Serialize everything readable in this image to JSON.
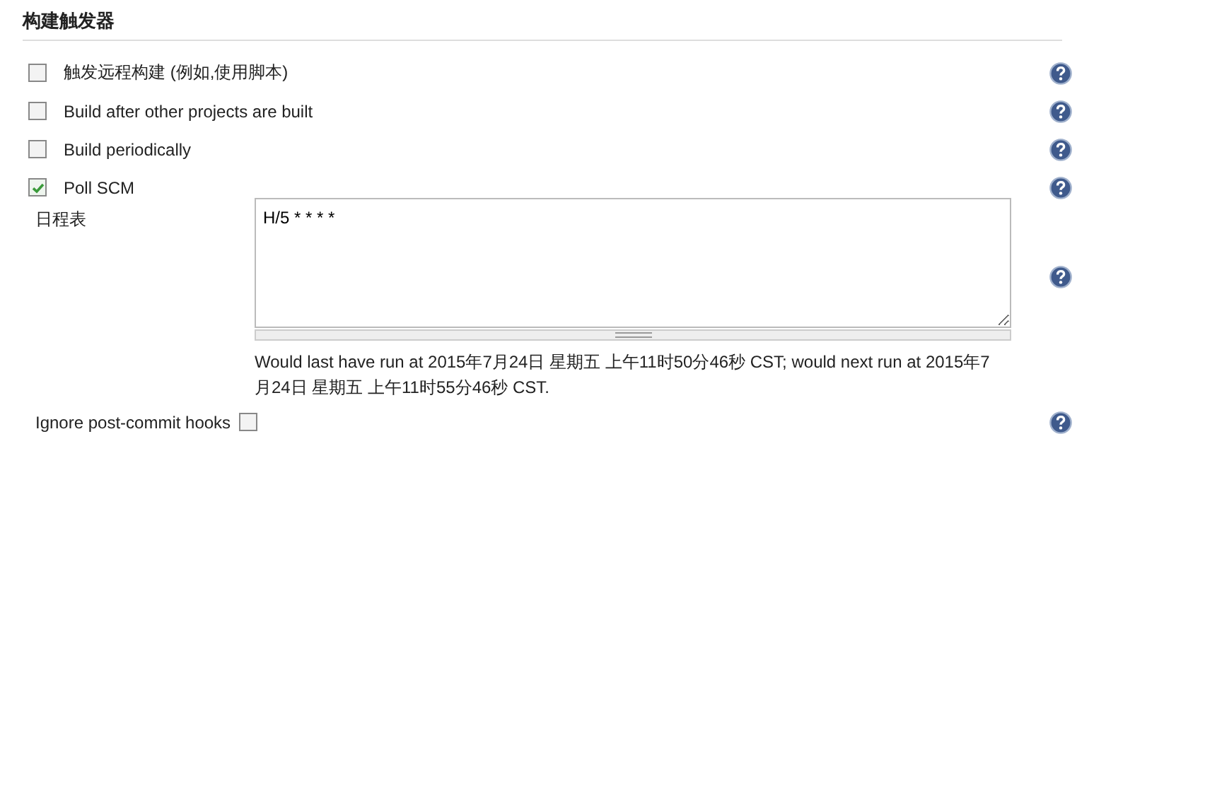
{
  "section": {
    "title": "构建触发器"
  },
  "triggers": [
    {
      "label": "触发远程构建 (例如,使用脚本)",
      "checked": false
    },
    {
      "label": "Build after other projects are built",
      "checked": false
    },
    {
      "label": "Build periodically",
      "checked": false
    },
    {
      "label": "Poll SCM",
      "checked": true
    }
  ],
  "schedule": {
    "label": "日程表",
    "value": "H/5 * * * *",
    "message": "Would last have run at 2015年7月24日 星期五 上午11时50分46秒 CST; would next run at 2015年7月24日 星期五 上午11时55分46秒 CST."
  },
  "ignore_hooks": {
    "label": "Ignore post-commit hooks",
    "checked": false
  }
}
